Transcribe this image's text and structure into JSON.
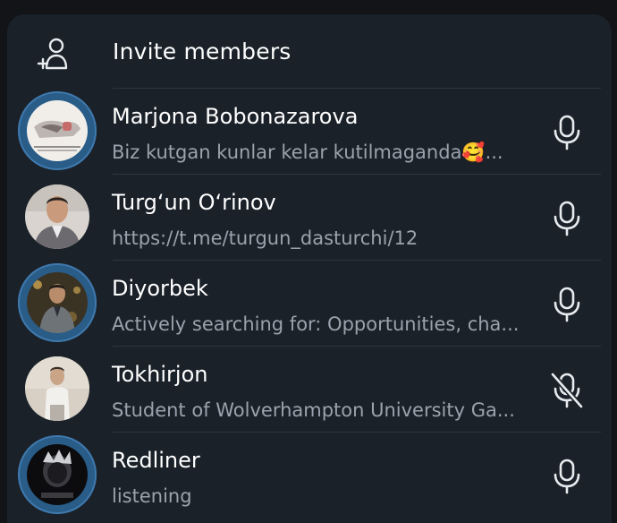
{
  "invite": {
    "label": "Invite members",
    "icon": "add-user-icon"
  },
  "members": [
    {
      "name": "Marjona Bobonazarova",
      "status": "Biz kutgan kunlar kelar kutilmaganda🥰...",
      "speaking_ring": true,
      "mic": "mic-icon",
      "muted": false
    },
    {
      "name": "Turg‘un O‘rinov",
      "status": "https://t.me/turgun_dasturchi/12",
      "speaking_ring": false,
      "mic": "mic-icon",
      "muted": false
    },
    {
      "name": "Diyorbek",
      "status": "Actively searching for: Opportunities, cha...",
      "speaking_ring": true,
      "mic": "mic-icon",
      "muted": false
    },
    {
      "name": "Tokhirjon",
      "status": "Student of Wolverhampton University Ga...",
      "speaking_ring": false,
      "mic": "mic-muted-icon",
      "muted": true
    },
    {
      "name": "Redliner",
      "status": "listening",
      "speaking_ring": true,
      "mic": "mic-icon",
      "muted": false
    }
  ],
  "colors": {
    "panel_bg": "#1a2129",
    "name_text": "#ffffff",
    "status_text": "#9aa3ad",
    "ring": "#2a5c88",
    "icon": "#e8ebee"
  }
}
